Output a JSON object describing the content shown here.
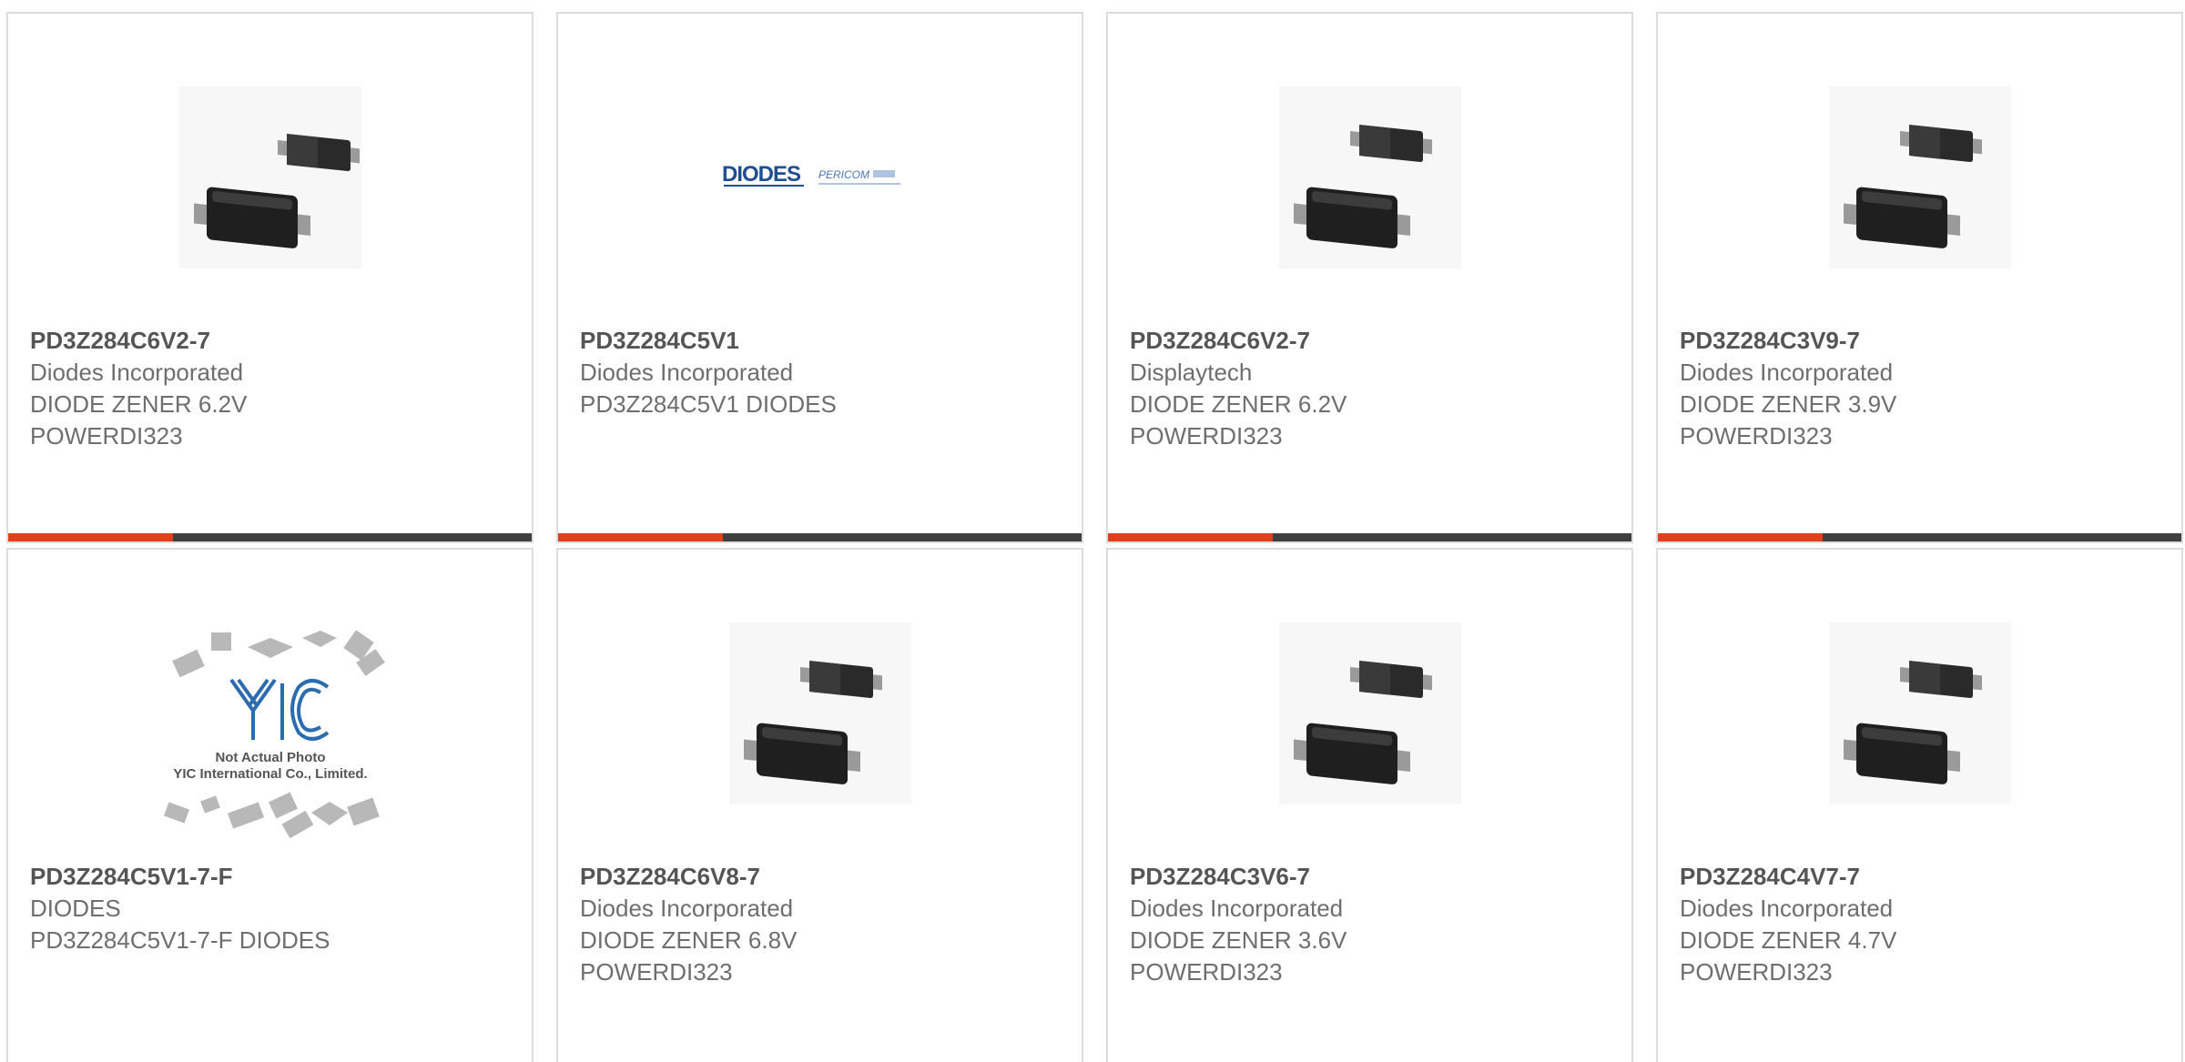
{
  "accent_color": "#e2401c",
  "bar_color": "#3f3f3f",
  "products": [
    {
      "part_number": "PD3Z284C6V2-7",
      "manufacturer": "Diodes Incorporated",
      "description_1": "DIODE ZENER 6.2V",
      "description_2": "POWERDI323",
      "image": "diode-package"
    },
    {
      "part_number": "PD3Z284C5V1",
      "manufacturer": "Diodes Incorporated",
      "description_1": "PD3Z284C5V1 DIODES",
      "description_2": "",
      "image": "diodes-pericom-logo",
      "logo_text_1": "DIODES",
      "logo_text_2": "PERICOM"
    },
    {
      "part_number": "PD3Z284C6V2-7",
      "manufacturer": "Displaytech",
      "description_1": "DIODE ZENER 6.2V",
      "description_2": "POWERDI323",
      "image": "diode-package"
    },
    {
      "part_number": "PD3Z284C3V9-7",
      "manufacturer": "Diodes Incorporated",
      "description_1": "DIODE ZENER 3.9V",
      "description_2": "POWERDI323",
      "image": "diode-package"
    },
    {
      "part_number": "PD3Z284C5V1-7-F",
      "manufacturer": "DIODES",
      "description_1": "PD3Z284C5V1-7-F DIODES",
      "description_2": "",
      "image": "not-actual-photo-placeholder",
      "placeholder_text_1": "Not Actual Photo",
      "placeholder_text_2": "YIC International Co., Limited.",
      "placeholder_logo": "YIC"
    },
    {
      "part_number": "PD3Z284C6V8-7",
      "manufacturer": "Diodes Incorporated",
      "description_1": "DIODE ZENER 6.8V",
      "description_2": "POWERDI323",
      "image": "diode-package"
    },
    {
      "part_number": "PD3Z284C3V6-7",
      "manufacturer": "Diodes Incorporated",
      "description_1": "DIODE ZENER 3.6V",
      "description_2": "POWERDI323",
      "image": "diode-package"
    },
    {
      "part_number": "PD3Z284C4V7-7",
      "manufacturer": "Diodes Incorporated",
      "description_1": "DIODE ZENER 4.7V",
      "description_2": "POWERDI323",
      "image": "diode-package"
    }
  ]
}
